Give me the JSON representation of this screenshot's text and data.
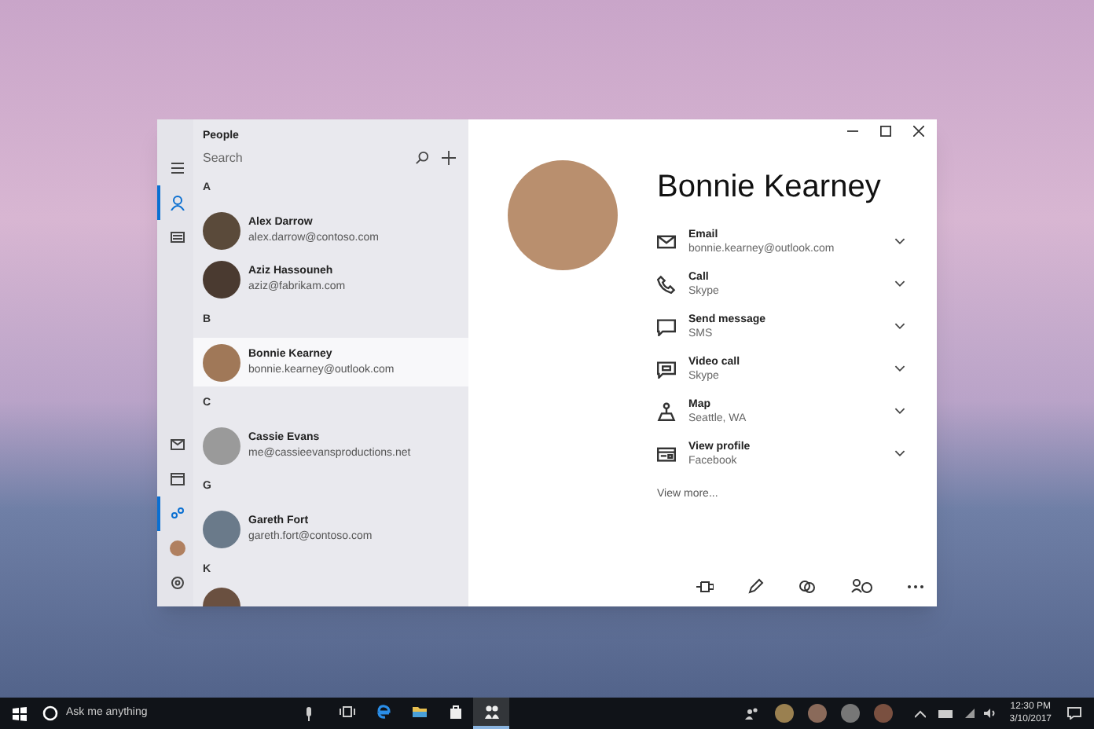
{
  "window": {
    "title": "People"
  },
  "nav": {
    "top": [
      {
        "kind": "menu",
        "selected": false
      },
      {
        "kind": "person",
        "selected": true
      },
      {
        "kind": "card",
        "selected": false
      }
    ],
    "bottom": [
      {
        "kind": "mail",
        "selected": false
      },
      {
        "kind": "calendar",
        "selected": false
      },
      {
        "kind": "people",
        "selected": true
      },
      {
        "kind": "avatar",
        "selected": false
      },
      {
        "kind": "settings",
        "selected": false
      }
    ]
  },
  "search": {
    "placeholder": "Search"
  },
  "groups": [
    {
      "letter": "A",
      "contacts": [
        {
          "name": "Alex Darrow",
          "email": "alex.darrow@contoso.com",
          "selected": false
        },
        {
          "name": "Aziz Hassouneh",
          "email": "aziz@fabrikam.com",
          "selected": false
        }
      ]
    },
    {
      "letter": "B",
      "contacts": [
        {
          "name": "Bonnie Kearney",
          "email": "bonnie.kearney@outlook.com",
          "selected": true
        }
      ]
    },
    {
      "letter": "C",
      "contacts": [
        {
          "name": "Cassie Evans",
          "email": "me@cassieevansproductions.net",
          "selected": false
        }
      ]
    },
    {
      "letter": "G",
      "contacts": [
        {
          "name": "Gareth Fort",
          "email": "gareth.fort@contoso.com",
          "selected": false
        }
      ]
    },
    {
      "letter": "K"
    }
  ],
  "detail": {
    "name": "Bonnie Kearney",
    "fields": [
      {
        "kind": "email",
        "label": "Email",
        "value": "bonnie.kearney@outlook.com"
      },
      {
        "kind": "call",
        "label": "Call",
        "value": "Skype"
      },
      {
        "kind": "message",
        "label": "Send message",
        "value": "SMS"
      },
      {
        "kind": "video",
        "label": "Video call",
        "value": "Skype"
      },
      {
        "kind": "map",
        "label": "Map",
        "value": "Seattle, WA"
      },
      {
        "kind": "profile",
        "label": "View profile",
        "value": "Facebook"
      }
    ],
    "more": "View more..."
  },
  "taskbar": {
    "search_placeholder": "Ask me anything",
    "apps": [
      {
        "kind": "taskview",
        "selected": false
      },
      {
        "kind": "edge",
        "selected": false
      },
      {
        "kind": "explorer",
        "selected": false
      },
      {
        "kind": "store",
        "selected": false
      },
      {
        "kind": "people",
        "selected": true
      }
    ],
    "time": "12:30 PM",
    "date": "3/10/2017"
  }
}
